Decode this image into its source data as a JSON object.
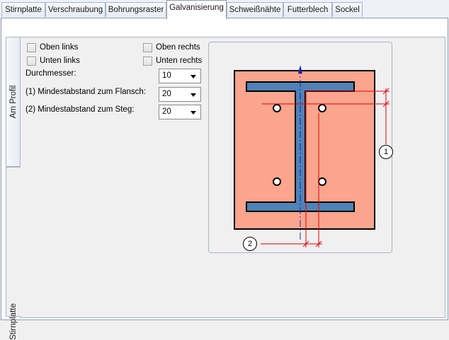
{
  "tabs": [
    {
      "label": "Stirnplatte"
    },
    {
      "label": "Verschraubung"
    },
    {
      "label": "Bohrungsraster"
    },
    {
      "label": "Galvanisierung"
    },
    {
      "label": "Schweißnähte"
    },
    {
      "label": "Futterblech"
    },
    {
      "label": "Sockel"
    }
  ],
  "active_tab": "Galvanisierung",
  "side_tabs": [
    {
      "label": "Am Profil"
    },
    {
      "label": "Stirnplatte"
    }
  ],
  "active_side_tab": "Stirnplatte",
  "options": {
    "oben_links": {
      "label": "Oben links",
      "checked": false
    },
    "oben_rechts": {
      "label": "Oben rechts",
      "checked": false
    },
    "unten_links": {
      "label": "Unten links",
      "checked": false
    },
    "unten_rechts": {
      "label": "Unten rechts",
      "checked": false
    }
  },
  "fields": {
    "durchmesser": {
      "label": "Durchmesser:",
      "value": "10"
    },
    "flansch": {
      "label": "(1) Mindestabstand zum Flansch:",
      "value": "20"
    },
    "steg": {
      "label": "(2) Mindestabstand zum Steg:",
      "value": "20"
    }
  },
  "diagram": {
    "marker_1": "1",
    "marker_2": "2",
    "colors": {
      "plate": "#fba58e",
      "profile": "#4f82b6",
      "dimension": "#e00000",
      "axis": "#1f1fb0"
    }
  }
}
